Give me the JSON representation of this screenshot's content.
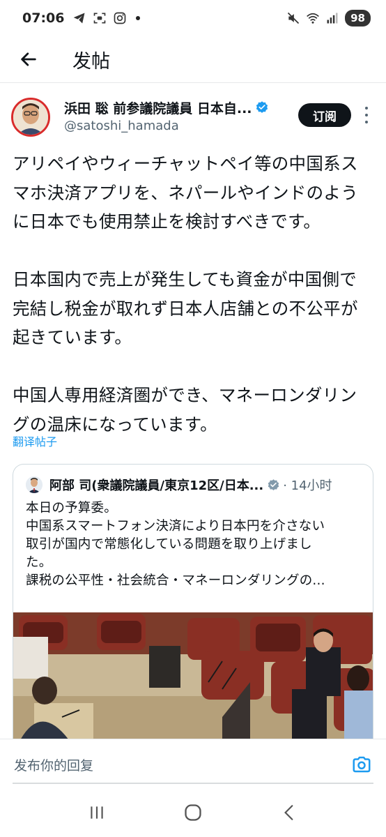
{
  "status_bar": {
    "time": "07:06",
    "battery": "98",
    "icons": [
      "telegram-icon",
      "screenshot-icon",
      "instagram-icon",
      "notification-dot",
      "mute-icon",
      "wifi-icon",
      "signal-icon"
    ]
  },
  "header": {
    "title": "发帖",
    "back_icon": "arrow-left-icon"
  },
  "post": {
    "author_name": "浜田 聡 前参議院議員 日本自...",
    "author_handle": "@satoshi_hamada",
    "verified": true,
    "subscribe_label": "订阅",
    "paragraphs": [
      [
        "アリペイやウィーチャットペイ等の中国系ス",
        "マホ決済アプリを、ネパールやインドのよう",
        "に日本でも使用禁止を検討すべきです。"
      ],
      [
        "日本国内で売上が発生しても資金が中国側で",
        "完結し税金が取れず日本人店舗との不公平が",
        "起きています。"
      ],
      [
        "中国人専用経済圏ができ、マネーロンダリン",
        "グの温床になっています。"
      ]
    ],
    "translate_label": "翻译帖子"
  },
  "quote": {
    "author_name": "阿部 司(衆議院議員/東京12区/日本...",
    "verified": true,
    "time": "· 14小时",
    "lines": [
      "本日の予算委。",
      "中国系スマートフォン決済により日本円を介さない",
      "取引が国内で常態化している問題を取り上げまし",
      "た。",
      "課税の公平性・社会統合・マネーロンダリングの..."
    ],
    "image_alt": "parliament-committee-photo"
  },
  "reply": {
    "placeholder": "发布你的回复",
    "camera_icon": "camera-icon"
  },
  "nav": {
    "icons": [
      "recent-apps-icon",
      "home-icon",
      "back-icon"
    ]
  },
  "colors": {
    "accent": "#1d9bf0",
    "text": "#0f1419",
    "secondary": "#536471",
    "verified": "#1d9bf0",
    "quote_verified": "#829aab"
  }
}
